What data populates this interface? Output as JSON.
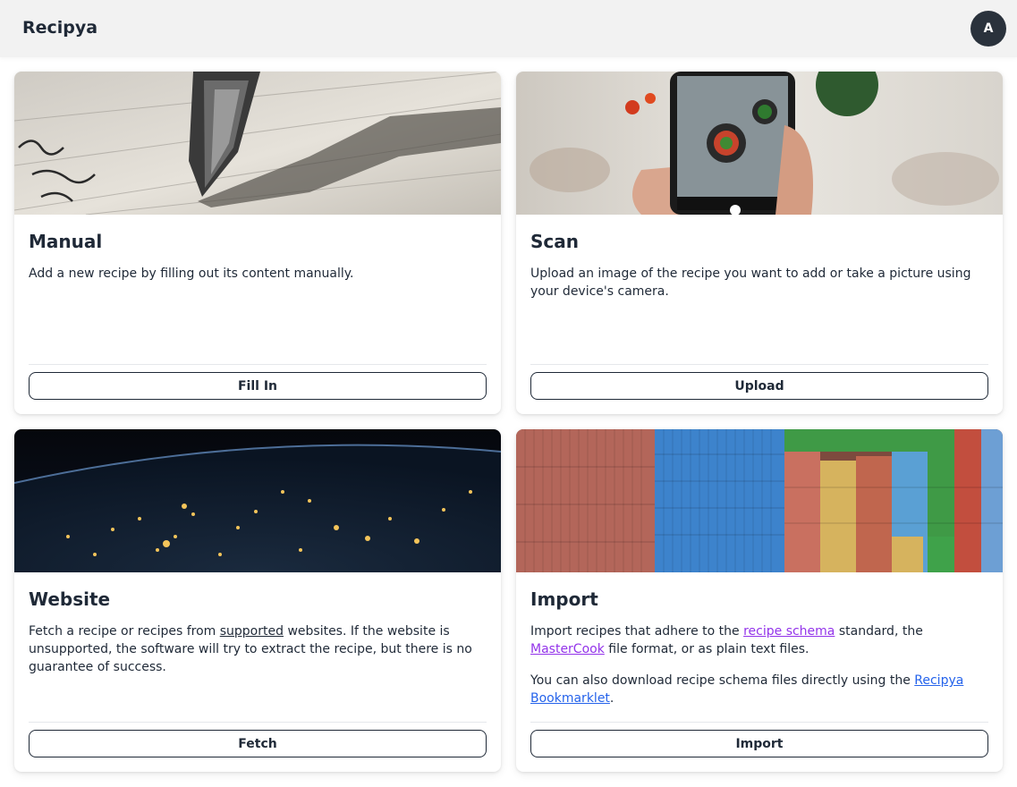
{
  "app": {
    "title": "Recipya",
    "avatar_initial": "A"
  },
  "cards": {
    "manual": {
      "title": "Manual",
      "description": "Add a new recipe by filling out its content manually.",
      "button": "Fill In"
    },
    "scan": {
      "title": "Scan",
      "description": "Upload an image of the recipe you want to add or take a picture using your device's camera.",
      "button": "Upload"
    },
    "website": {
      "title": "Website",
      "text_before_link": "Fetch a recipe or recipes from ",
      "link": "supported",
      "text_after_link": " websites. If the website is unsupported, the software will try to extract the recipe, but there is no guarantee of success.",
      "button": "Fetch"
    },
    "import": {
      "title": "Import",
      "p1_part1": "Import recipes that adhere to the ",
      "p1_link1": "recipe schema",
      "p1_part2": " standard, the ",
      "p1_link2": "MasterCook",
      "p1_part3": " file format, or as plain text files.",
      "p2_part1": "You can also download recipe schema files directly using the ",
      "p2_link": "Recipya Bookmarklet",
      "p2_part2": ".",
      "button": "Import"
    }
  },
  "colors": {
    "avatar_bg": "#2a323c",
    "link_purple": "#9333ea",
    "link_blue": "#2563eb",
    "topbar_bg": "#f2f2f2"
  }
}
